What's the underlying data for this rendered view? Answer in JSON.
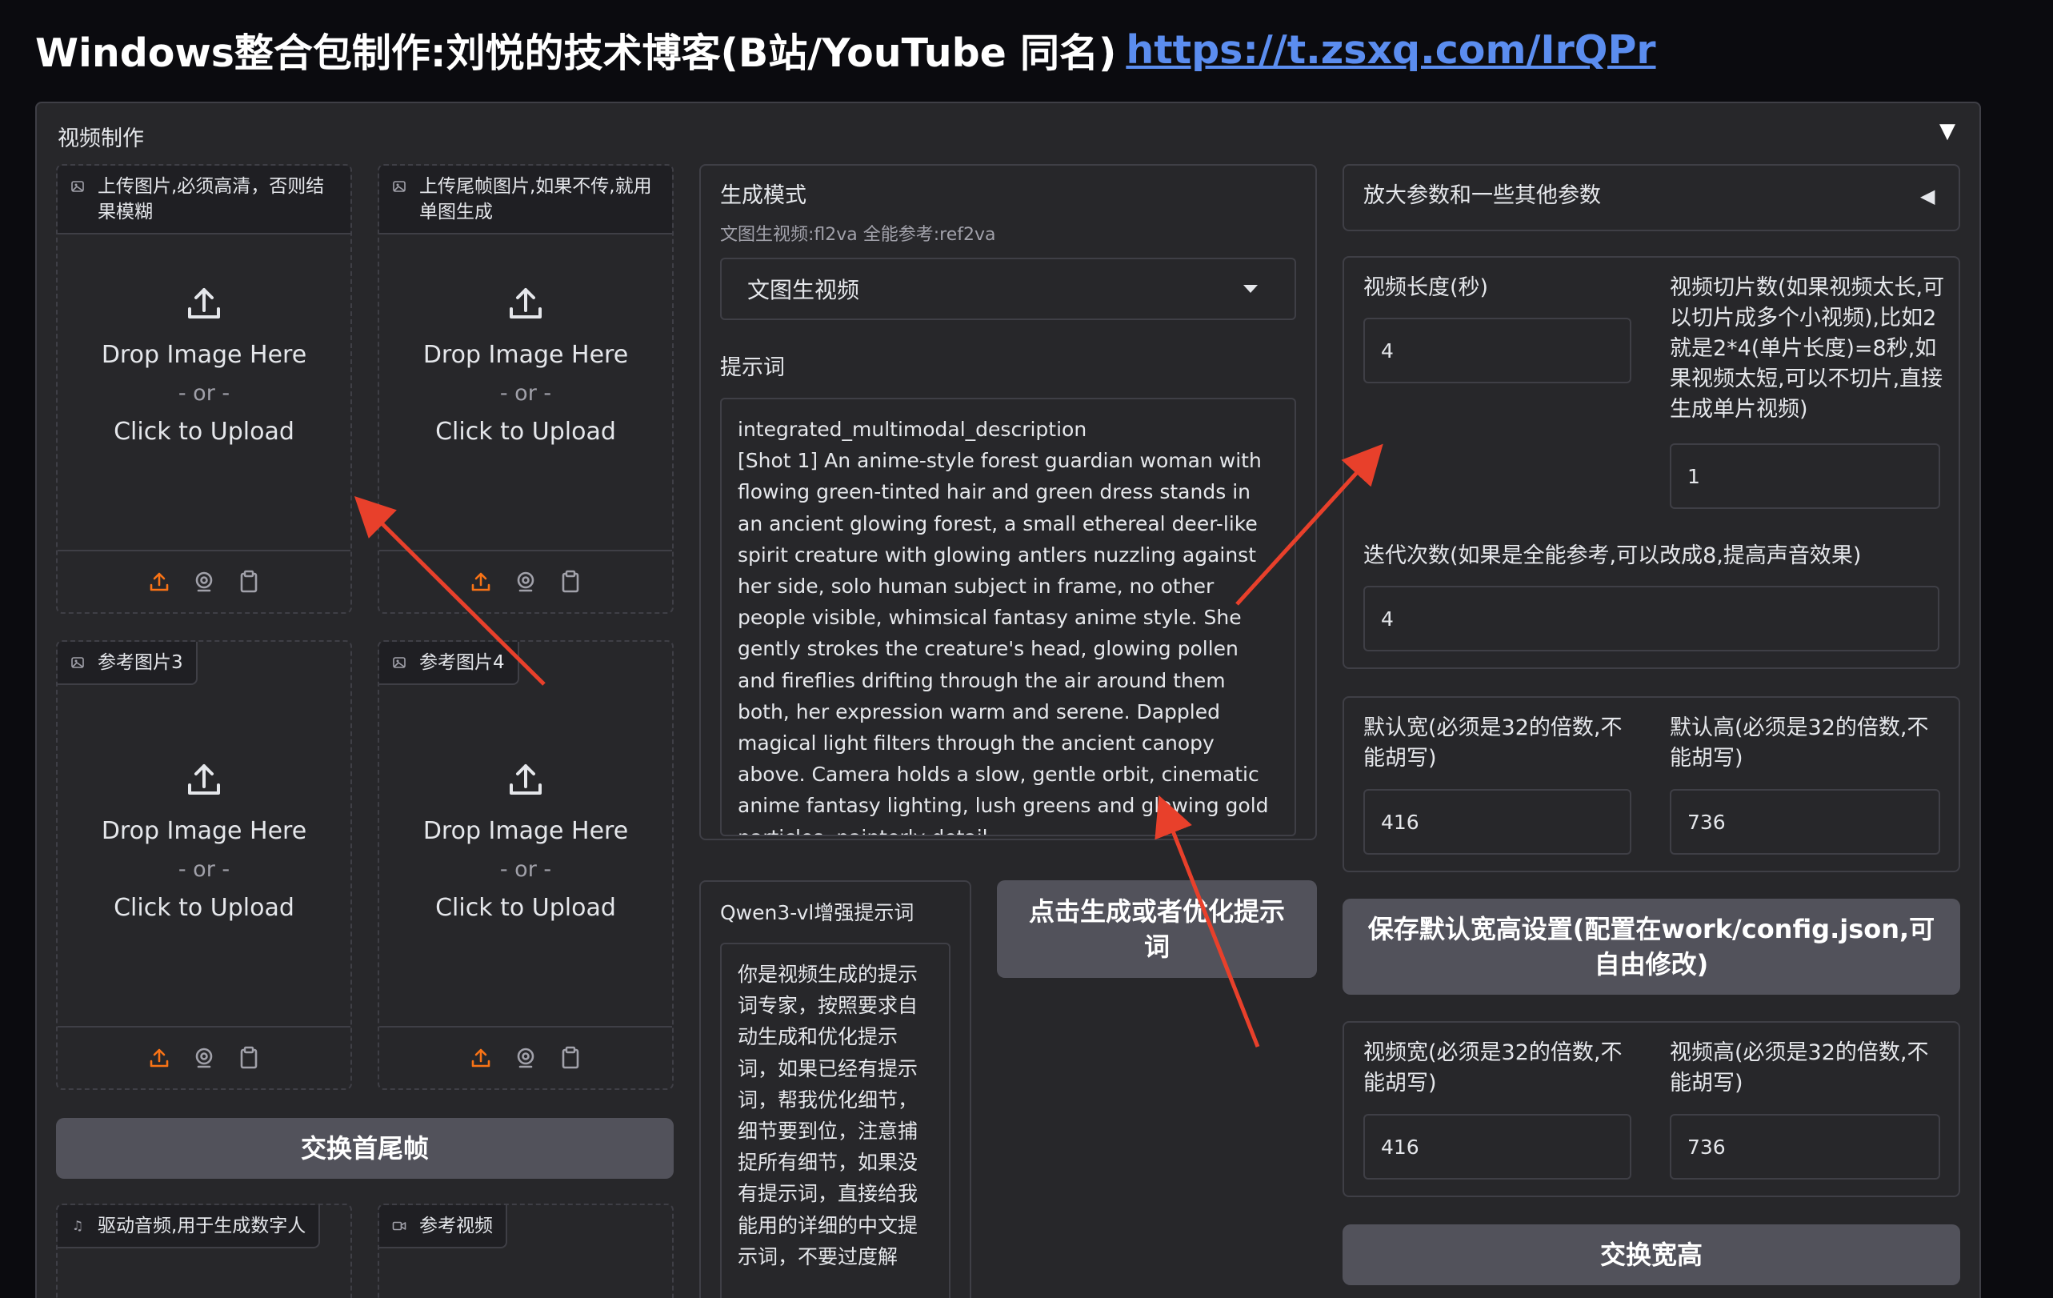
{
  "header": {
    "title": "Windows整合包制作:刘悦的技术博客(B站/YouTube 同名)",
    "link": "https://t.zsxq.com/IrQPr"
  },
  "panel": {
    "title": "视频制作",
    "toggle": "▼"
  },
  "uploads": [
    {
      "label": "上传图片,必须高清，否则结果模糊"
    },
    {
      "label": "上传尾帧图片,如果不传,就用单图生成"
    },
    {
      "label": "参考图片3"
    },
    {
      "label": "参考图片4"
    }
  ],
  "drop": {
    "main": "Drop Image Here",
    "or": "- or -",
    "click": "Click to Upload"
  },
  "swap_frames_button": "交换首尾帧",
  "audio_upload_label": "驱动音频,用于生成数字人",
  "video_upload_label": "参考视频",
  "mode": {
    "label": "生成模式",
    "info": "文图生视频:fl2va 全能参考:ref2va",
    "selected": "文图生视频"
  },
  "prompt": {
    "label": "提示词",
    "value": "integrated_multimodal_description\n[Shot 1] An anime-style forest guardian woman with flowing green-tinted hair and green dress stands in an ancient glowing forest, a small ethereal deer-like spirit creature with glowing antlers nuzzling against her side, solo human subject in frame, no other people visible, whimsical fantasy anime style. She gently strokes the creature's head, glowing pollen and fireflies drifting through the air around them both, her expression warm and serene. Dappled magical light filters through the ancient canopy above. Camera holds a slow, gentle orbit, cinematic anime fantasy lighting, lush greens and glowing gold particles, painterly detail."
  },
  "qwen": {
    "label": "Qwen3-vl增强提示词",
    "value": "你是视频生成的提示词专家，按照要求自动生成和优化提示词，如果已经有提示词，帮我优化细节，细节要到位，注意捕捉所有细节，如果没有提示词，直接给我能用的详细的中文提示词，不要过度解"
  },
  "generate_button": "点击生成或者优化提示词",
  "advanced": {
    "title": "放大参数和一些其他参数",
    "toggle": "◀"
  },
  "video_length": {
    "label": "视频长度(秒)",
    "value": "4"
  },
  "slices": {
    "label": "视频切片数(如果视频太长,可以切片成多个小视频),比如2就是2*4(单片长度)=8秒,如果视频太短,可以不切片,直接生成单片视频)",
    "value": "1"
  },
  "iterations": {
    "label": "迭代次数(如果是全能参考,可以改成8,提高声音效果)",
    "value": "4"
  },
  "default_width": {
    "label": "默认宽(必须是32的倍数,不能胡写)",
    "value": "416"
  },
  "default_height": {
    "label": "默认高(必须是32的倍数,不能胡写)",
    "value": "736"
  },
  "save_default_button": "保存默认宽高设置(配置在work/config.json,可自由修改)",
  "video_width": {
    "label": "视频宽(必须是32的倍数,不能胡写)",
    "value": "416"
  },
  "video_height": {
    "label": "视频高(必须是32的倍数,不能胡写)",
    "value": "736"
  },
  "swap_wh_button": "交换宽高",
  "colors": {
    "accent": "#f97316",
    "link": "#5b8def",
    "arrow": "#e8402b"
  }
}
